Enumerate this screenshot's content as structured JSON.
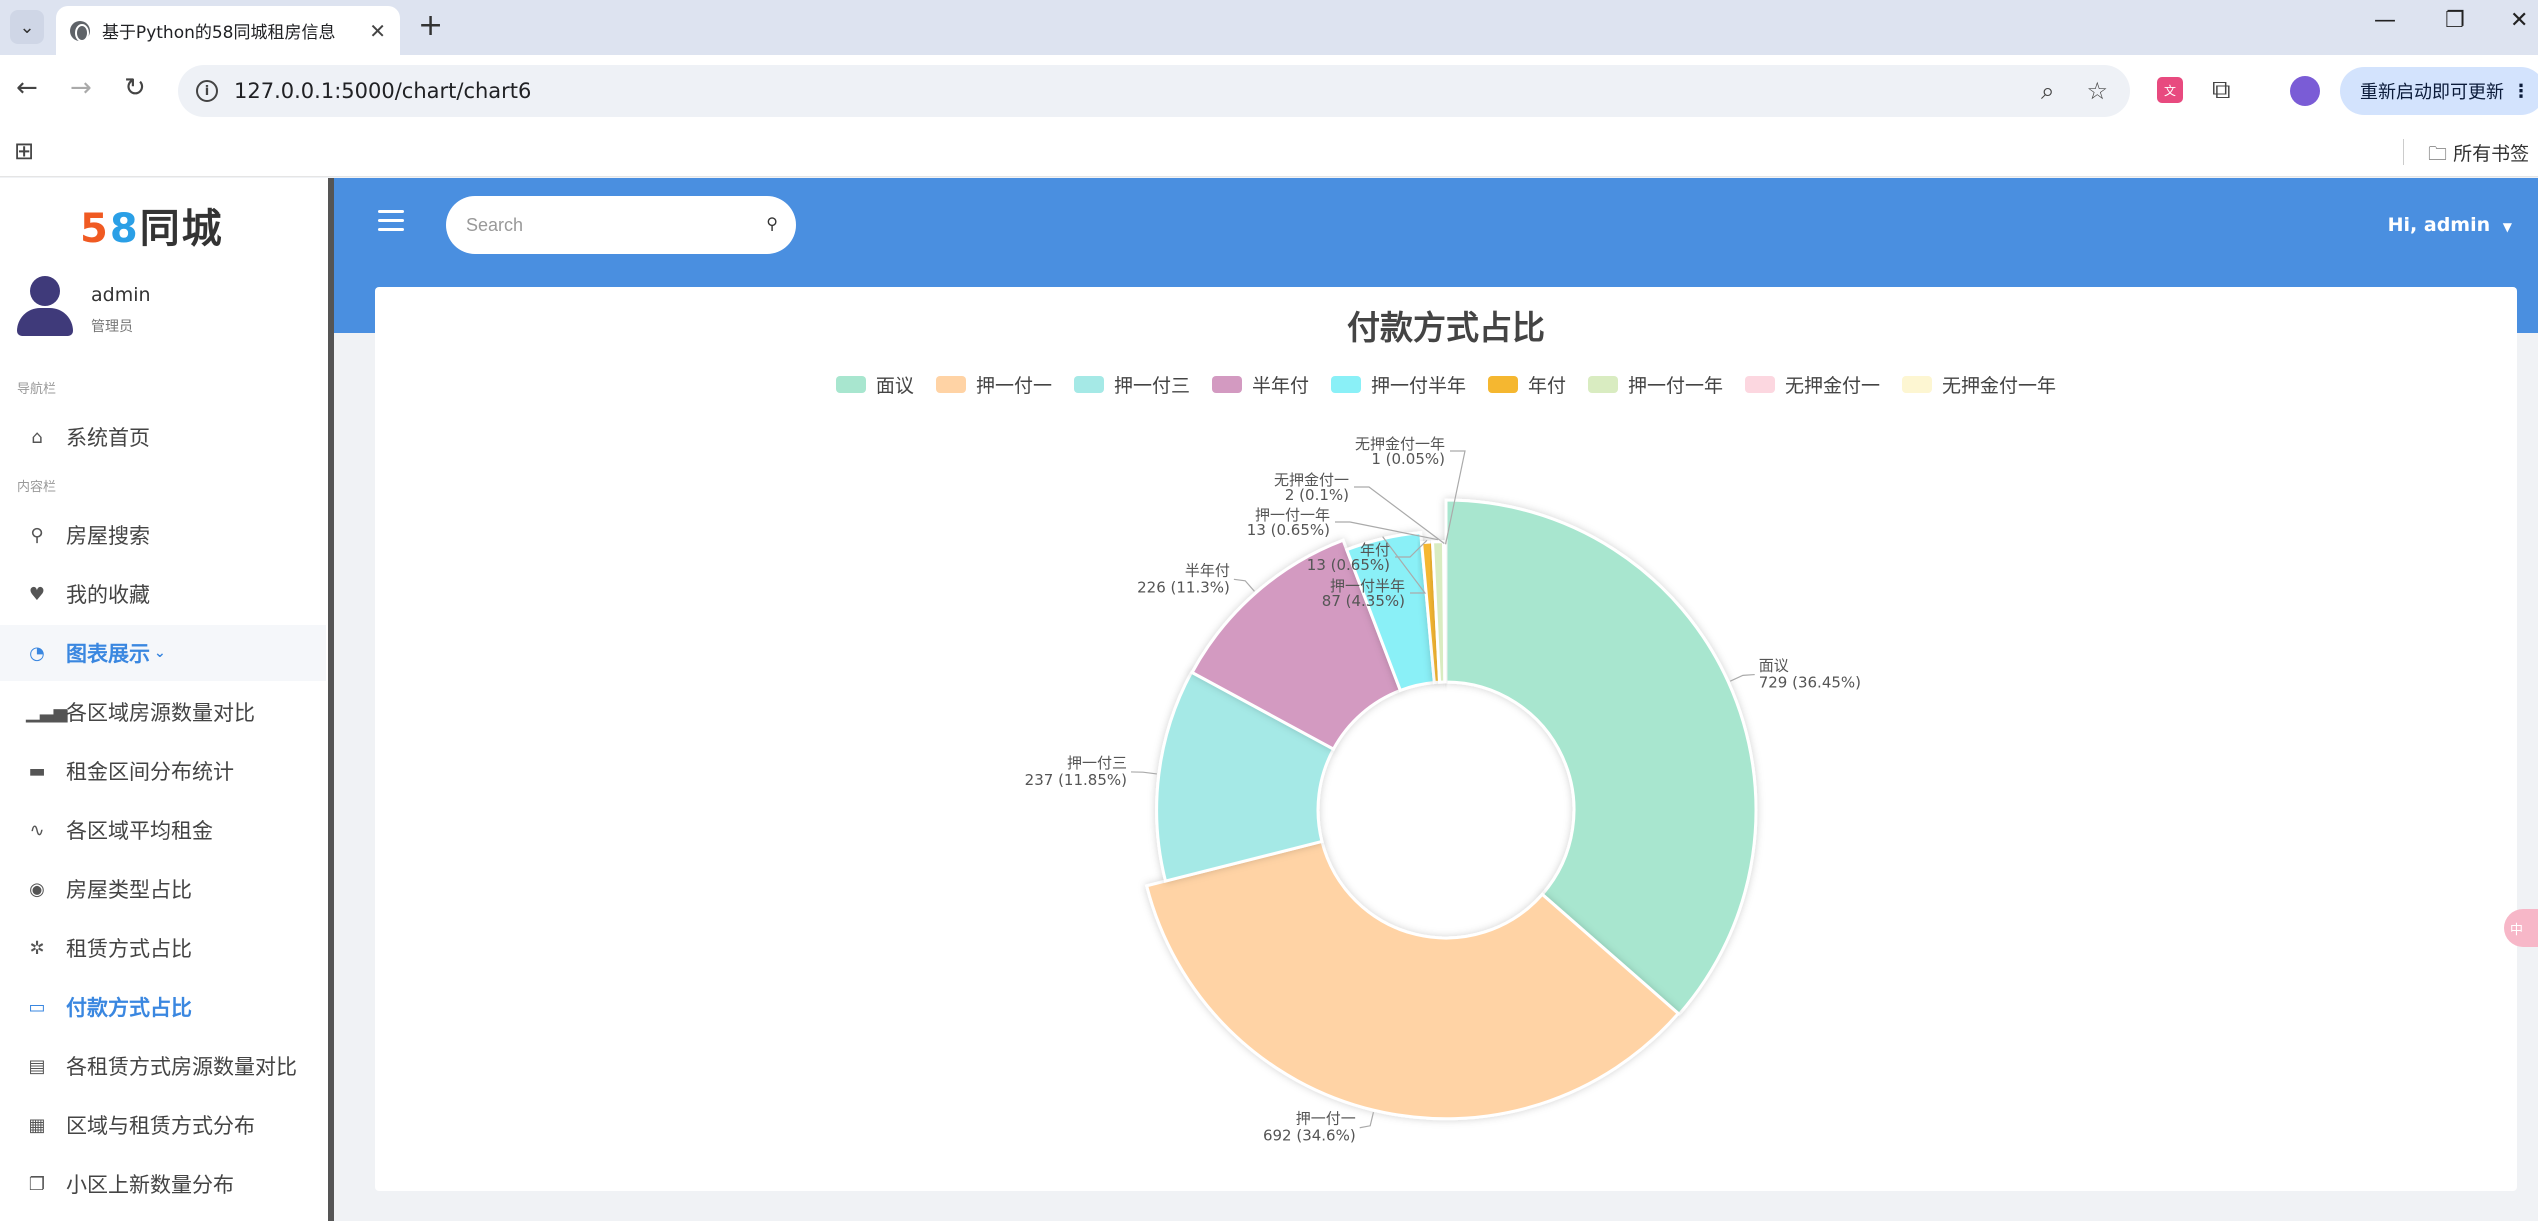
{
  "browser": {
    "tab_title": "基于Python的58同城租房信息",
    "url": "127.0.0.1:5000/chart/chart6",
    "update_label": "重新启动即可更新",
    "bookmarks_label": "所有书签"
  },
  "sidebar": {
    "logo": {
      "five": "5",
      "eight": "8",
      "text": "同城"
    },
    "user_name": "admin",
    "user_role": "管理员",
    "section_nav": "导航栏",
    "section_content": "内容栏",
    "items": [
      {
        "label": "系统首页",
        "icon": "home-icon"
      },
      {
        "label": "房屋搜索",
        "icon": "search-icon"
      },
      {
        "label": "我的收藏",
        "icon": "heart-icon"
      },
      {
        "label": "图表展示",
        "icon": "pie-icon"
      },
      {
        "label": "各区域房源数量对比",
        "icon": "bar-chart-icon"
      },
      {
        "label": "租金区间分布统计",
        "icon": "table-icon"
      },
      {
        "label": "各区域平均租金",
        "icon": "pulse-icon"
      },
      {
        "label": "房屋类型占比",
        "icon": "gauge-icon"
      },
      {
        "label": "租赁方式占比",
        "icon": "asterisk-icon"
      },
      {
        "label": "付款方式占比",
        "icon": "grid-icon"
      },
      {
        "label": "各租赁方式房源数量对比",
        "icon": "book-icon"
      },
      {
        "label": "区域与租赁方式分布",
        "icon": "calendar-icon"
      },
      {
        "label": "小区上新数量分布",
        "icon": "copy-icon"
      }
    ]
  },
  "topbar": {
    "search_placeholder": "Search",
    "user_greeting": "Hi, admin"
  },
  "chart_data": {
    "type": "pie",
    "title": "付款方式占比",
    "legend_position": "top-center",
    "donut": true,
    "categories": [
      "面议",
      "押一付一",
      "押一付三",
      "半年付",
      "押一付半年",
      "年付",
      "押一付一年",
      "无押金付一",
      "无押金付一年"
    ],
    "values": [
      729,
      692,
      237,
      226,
      87,
      13,
      13,
      2,
      1
    ],
    "percent_labels": [
      "729 (36.45%)",
      "692 (34.6%)",
      "237 (11.85%)",
      "226 (11.3%)",
      "87 (4.35%)",
      "13 (0.65%)",
      "13 (0.65%)",
      "2 (0.1%)",
      "1 (0.05%)"
    ],
    "colors": [
      "#a8e6cf",
      "#ffd3a5",
      "#a5e9e6",
      "#d39ac1",
      "#8af0f7",
      "#f5b730",
      "#d9ecc1",
      "#fcd7e0",
      "#fdf6d2"
    ]
  }
}
